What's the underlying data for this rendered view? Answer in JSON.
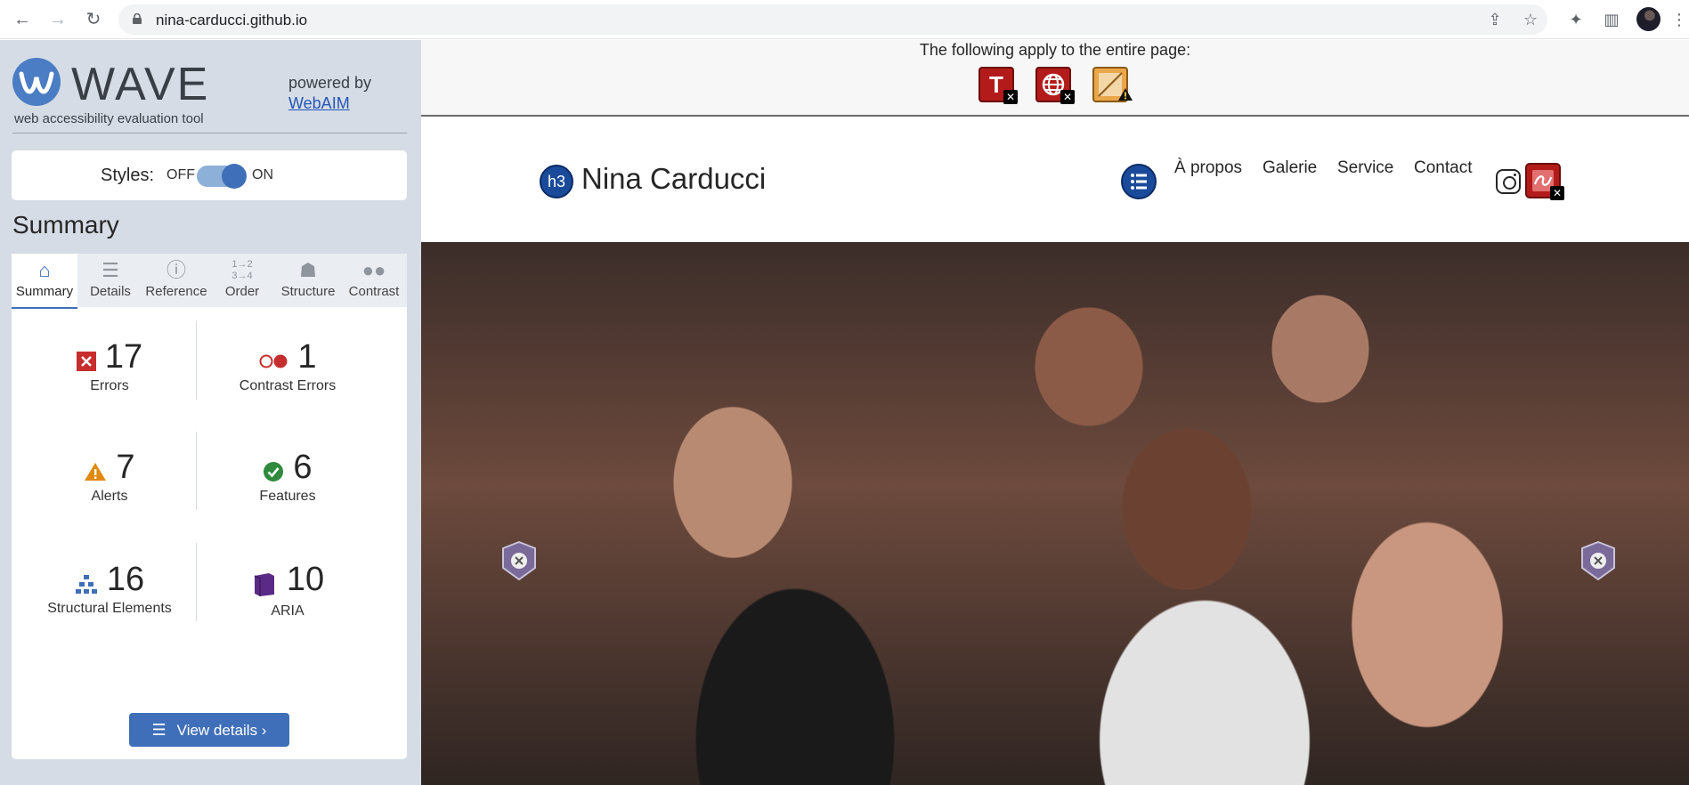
{
  "browser": {
    "url": "nina-carducci.github.io",
    "nav_icons": [
      "back-arrow-icon",
      "forward-arrow-icon",
      "reload-icon"
    ],
    "addr_icons": [
      "share-icon",
      "star-icon"
    ],
    "toolbar_icons": [
      "puzzle-icon",
      "side-panel-icon",
      "profile-avatar",
      "more-vert-icon"
    ]
  },
  "wave": {
    "title": "WAVE",
    "subtitle": "web accessibility evaluation tool",
    "powered_by": "powered by",
    "webaim_link": "WebAIM",
    "styles_label": "Styles:",
    "styles_off": "OFF",
    "styles_on": "ON",
    "styles_state": "on",
    "summary_heading": "Summary",
    "tabs": [
      {
        "label": "Summary",
        "icon": "home-icon",
        "active": true
      },
      {
        "label": "Details",
        "icon": "list-icon",
        "active": false
      },
      {
        "label": "Reference",
        "icon": "info-icon",
        "active": false
      },
      {
        "label": "Order",
        "icon": "order-icon",
        "active": false
      },
      {
        "label": "Structure",
        "icon": "structure-icon",
        "active": false
      },
      {
        "label": "Contrast",
        "icon": "contrast-icon",
        "active": false
      }
    ],
    "metrics": {
      "errors": {
        "value": "17",
        "label": "Errors"
      },
      "contrast": {
        "value": "1",
        "label": "Contrast Errors"
      },
      "alerts": {
        "value": "7",
        "label": "Alerts"
      },
      "features": {
        "value": "6",
        "label": "Features"
      },
      "structural": {
        "value": "16",
        "label": "Structural Elements"
      },
      "aria": {
        "value": "10",
        "label": "ARIA"
      }
    },
    "view_details": "View details ›",
    "colors": {
      "accent": "#3f6fb8",
      "error": "#c62d2d",
      "alert": "#e08a12",
      "feature": "#2f8a3c",
      "aria": "#5b2a86"
    }
  },
  "page": {
    "banner_text": "The following apply to the entire page:",
    "banner_icons": [
      "missing-title-error-icon",
      "language-missing-error-icon",
      "page-alert-icon"
    ],
    "h3_badge": "h3",
    "site_title": "Nina Carducci",
    "nav": [
      "À propos",
      "Galerie",
      "Service",
      "Contact"
    ],
    "hero_image": "concert-crowd-photo"
  }
}
